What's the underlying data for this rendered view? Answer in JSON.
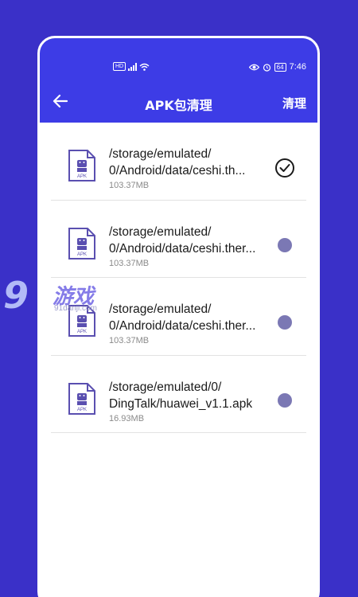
{
  "status_bar": {
    "hd": "HD",
    "signal_icon": "signal-icon",
    "wifi_icon": "wifi-icon",
    "eye_icon": "eye-icon",
    "alarm_icon": "alarm-icon",
    "battery": "64",
    "time": "7:46"
  },
  "header": {
    "title": "APK包清理",
    "action": "清理",
    "back_icon": "back-arrow-icon"
  },
  "files": [
    {
      "path_line1": "/storage/emulated/",
      "path_line2": "0/Android/data/ceshi.th...",
      "size": "103.37MB",
      "state": "checked"
    },
    {
      "path_line1": "/storage/emulated/",
      "path_line2": "0/Android/data/ceshi.ther...",
      "size": "103.37MB",
      "state": "unchecked"
    },
    {
      "path_line1": "/storage/emulated/",
      "path_line2": "0/Android/data/ceshi.ther...",
      "size": "103.37MB",
      "state": "unchecked"
    },
    {
      "path_line1": "/storage/emulated/0/",
      "path_line2": "DingTalk/huawei_v1.1.apk",
      "size": "16.93MB",
      "state": "unchecked"
    }
  ],
  "file_icon_label": "APK",
  "watermark": {
    "number": "9",
    "text": "游戏",
    "url": "91danji.com"
  },
  "colors": {
    "background": "#3a30c8",
    "header": "#3d3ce6",
    "radio": "#7b78b4",
    "icon": "#5a4fb0"
  }
}
